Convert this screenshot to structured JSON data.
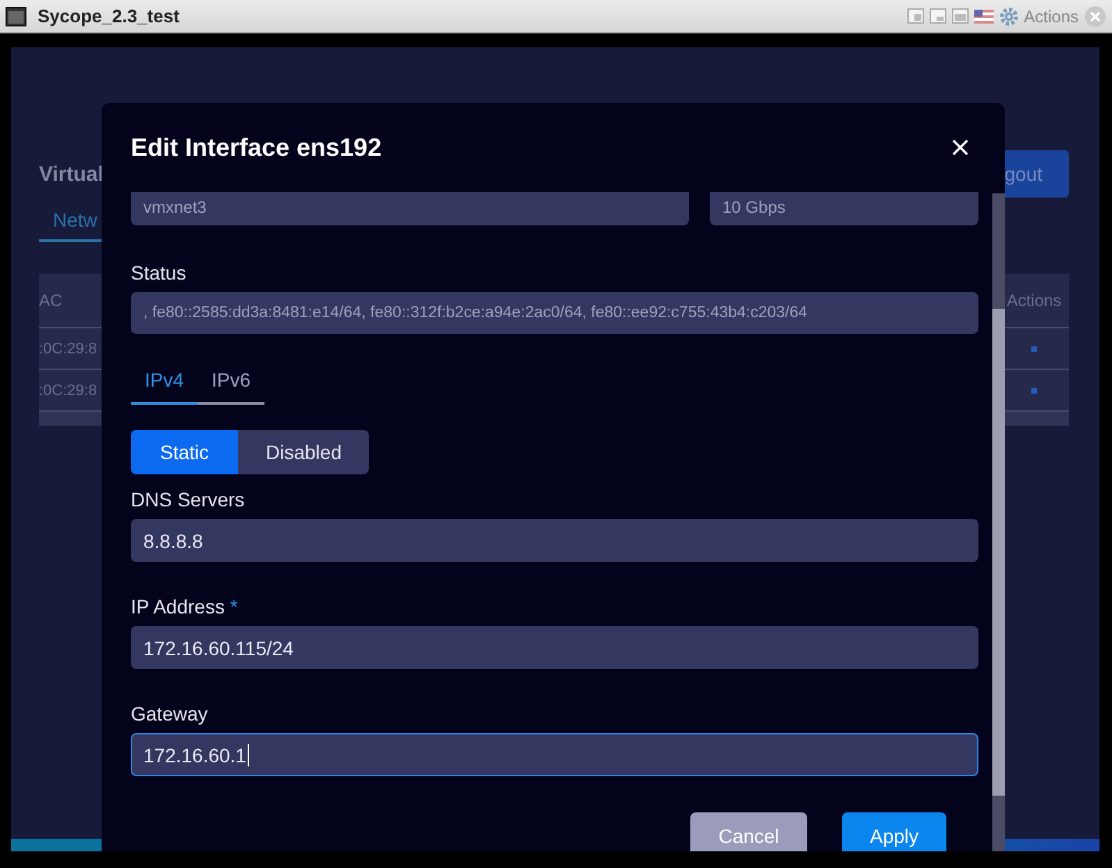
{
  "window": {
    "title": "Sycope_2.3_test",
    "actions_label": "Actions"
  },
  "background": {
    "heading": "Virtual",
    "tab": "Netw",
    "logout": "gout",
    "table": {
      "columns": [
        "AC",
        "Actions"
      ],
      "rows": [
        {
          "mac": ":0C:29:8"
        },
        {
          "mac": ":0C:29:8"
        }
      ]
    }
  },
  "dialog": {
    "title": "Edit Interface ens192",
    "top_fields": [
      {
        "value": "vmxnet3"
      },
      {
        "value": "10 Gbps"
      }
    ],
    "status": {
      "label": "Status",
      "value": ", fe80::2585:dd3a:8481:e14/64, fe80::312f:b2ce:a94e:2ac0/64, fe80::ee92:c755:43b4:c203/64"
    },
    "tabs": [
      {
        "label": "IPv4",
        "selected": true
      },
      {
        "label": "IPv6",
        "selected": false
      }
    ],
    "mode": [
      {
        "label": "Static",
        "selected": true
      },
      {
        "label": "Disabled",
        "selected": false
      }
    ],
    "fields": [
      {
        "label": "DNS Servers",
        "value": "8.8.8.8",
        "focused": false
      },
      {
        "label": "IP Address",
        "required_mark": "*",
        "value": "172.16.60.115/24",
        "focused": false
      },
      {
        "label": "Gateway",
        "value": "172.16.60.1",
        "focused": true
      }
    ],
    "buttons": [
      {
        "label": "Cancel",
        "kind": "secondary"
      },
      {
        "label": "Apply",
        "kind": "primary"
      }
    ]
  }
}
